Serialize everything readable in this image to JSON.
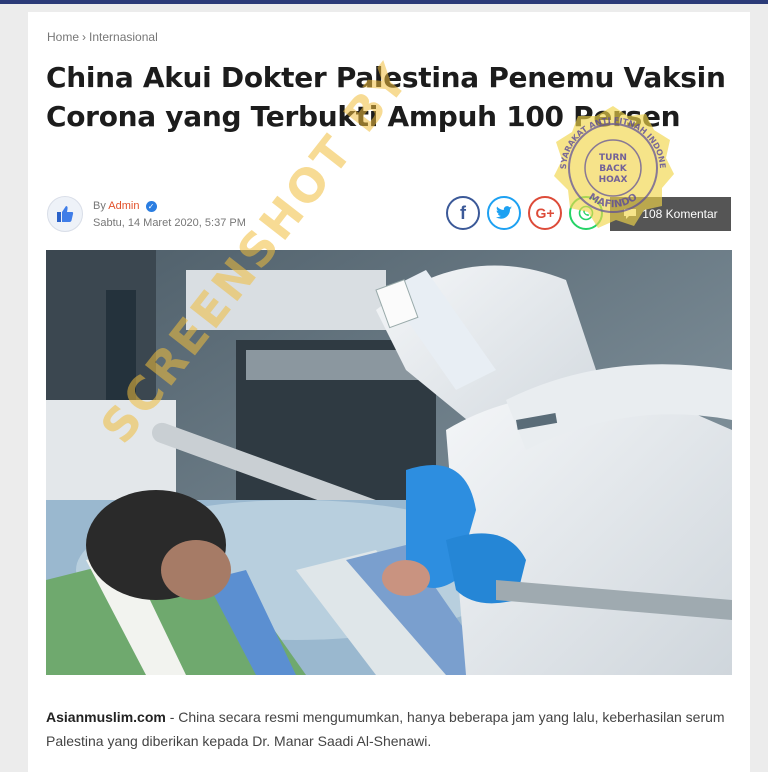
{
  "breadcrumb": {
    "home": "Home",
    "separator": "›",
    "category": "Internasional"
  },
  "article": {
    "title": "China Akui Dokter Palestina Penemu Vaksin Corona yang Terbukti Ampuh 100 Persen",
    "by_prefix": "By",
    "author": "Admin",
    "date": "Sabtu, 14 Maret 2020,",
    "time": "5:37 PM",
    "comments_label": "108 Komentar",
    "lede_source": "Asianmuslim.com",
    "lede_text": " - China secara resmi mengumumkan, hanya beberapa jam yang lalu, keberhasilan serum Palestina yang diberikan kepada Dr. Manar Saadi Al-Shenawi."
  },
  "share": {
    "facebook_glyph": "f",
    "google_glyph": "G+"
  },
  "watermark": {
    "text": "SCREENSHOT BY",
    "seal_top": "MASYARAKAT ANTI FITNAH INDONESIA",
    "seal_bottom": "MAFINDO",
    "seal_center": "TURN BACK HOAX"
  },
  "colors": {
    "accent": "#e2502a",
    "facebook": "#3b5998",
    "twitter": "#1da1f2",
    "google": "#dd4b39",
    "whatsapp": "#25d366",
    "seal": "#f1d54a",
    "seal_ink": "#5a4a9a"
  }
}
